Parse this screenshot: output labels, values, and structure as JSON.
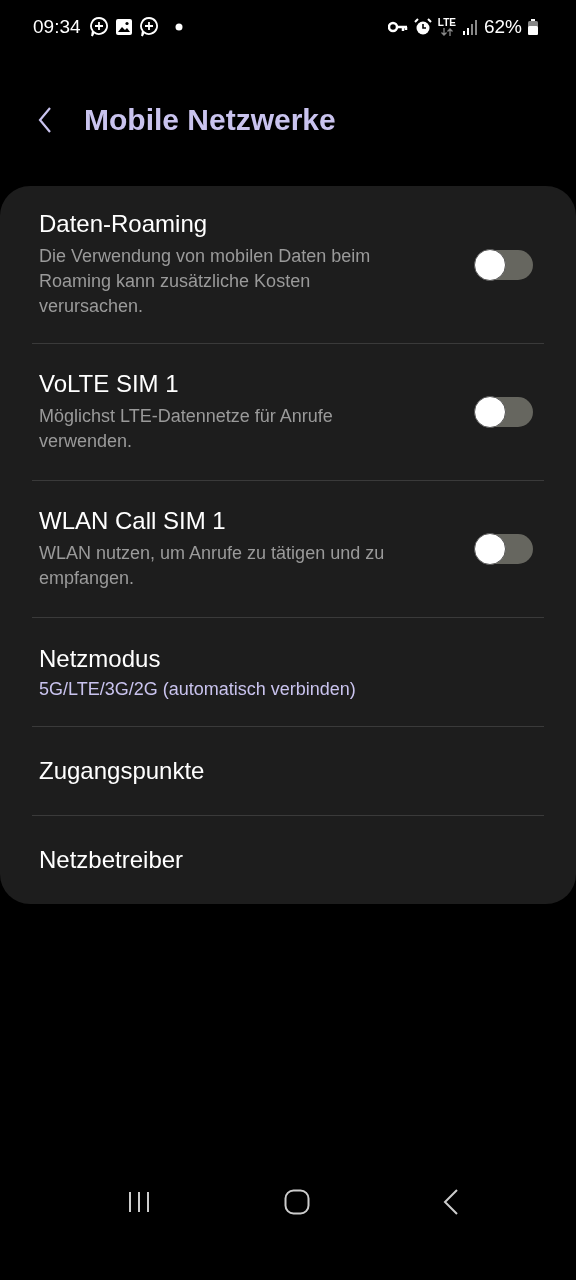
{
  "status_bar": {
    "time": "09:34",
    "network": "LTE",
    "battery": "62%"
  },
  "header": {
    "title": "Mobile Netzwerke"
  },
  "settings": [
    {
      "kind": "toggle",
      "title": "Daten-Roaming",
      "description": "Die Verwendung von mobilen Daten beim Roaming kann zusätzliche Kosten verursachen.",
      "on": false
    },
    {
      "kind": "toggle",
      "title": "VoLTE SIM 1",
      "description": "Möglichst LTE-Datennetze für Anrufe verwenden.",
      "on": false
    },
    {
      "kind": "toggle",
      "title": "WLAN Call SIM 1",
      "description": "WLAN nutzen, um Anrufe zu tätigen und zu empfangen.",
      "on": false
    },
    {
      "kind": "value",
      "title": "Netzmodus",
      "value": "5G/LTE/3G/2G (automatisch verbinden)"
    },
    {
      "kind": "plain",
      "title": "Zugangspunkte"
    },
    {
      "kind": "plain",
      "title": "Netzbetreiber"
    }
  ]
}
